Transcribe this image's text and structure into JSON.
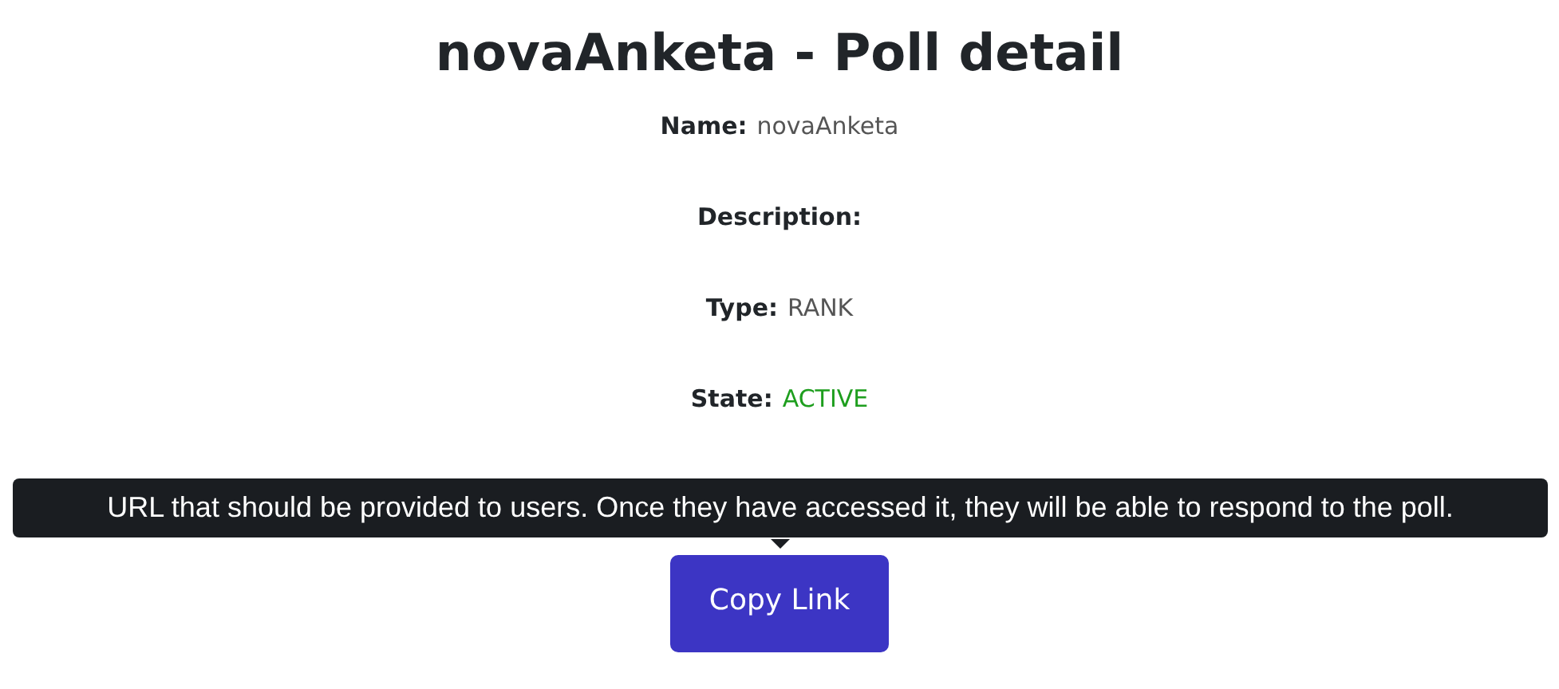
{
  "title": "novaAnketa - Poll detail",
  "fields": [
    {
      "label": "Name:",
      "value": "novaAnketa",
      "color": "#555555"
    },
    {
      "label": "Description:"
    },
    {
      "label": "Type:",
      "value": "RANK",
      "color": "#555555"
    },
    {
      "label": "State:",
      "value": "ACTIVE",
      "color": "#1e9e1e"
    }
  ],
  "tooltip": "URL that should be provided to users. Once they have accessed it, they will be able to respond to the poll.",
  "button": "Copy Link"
}
